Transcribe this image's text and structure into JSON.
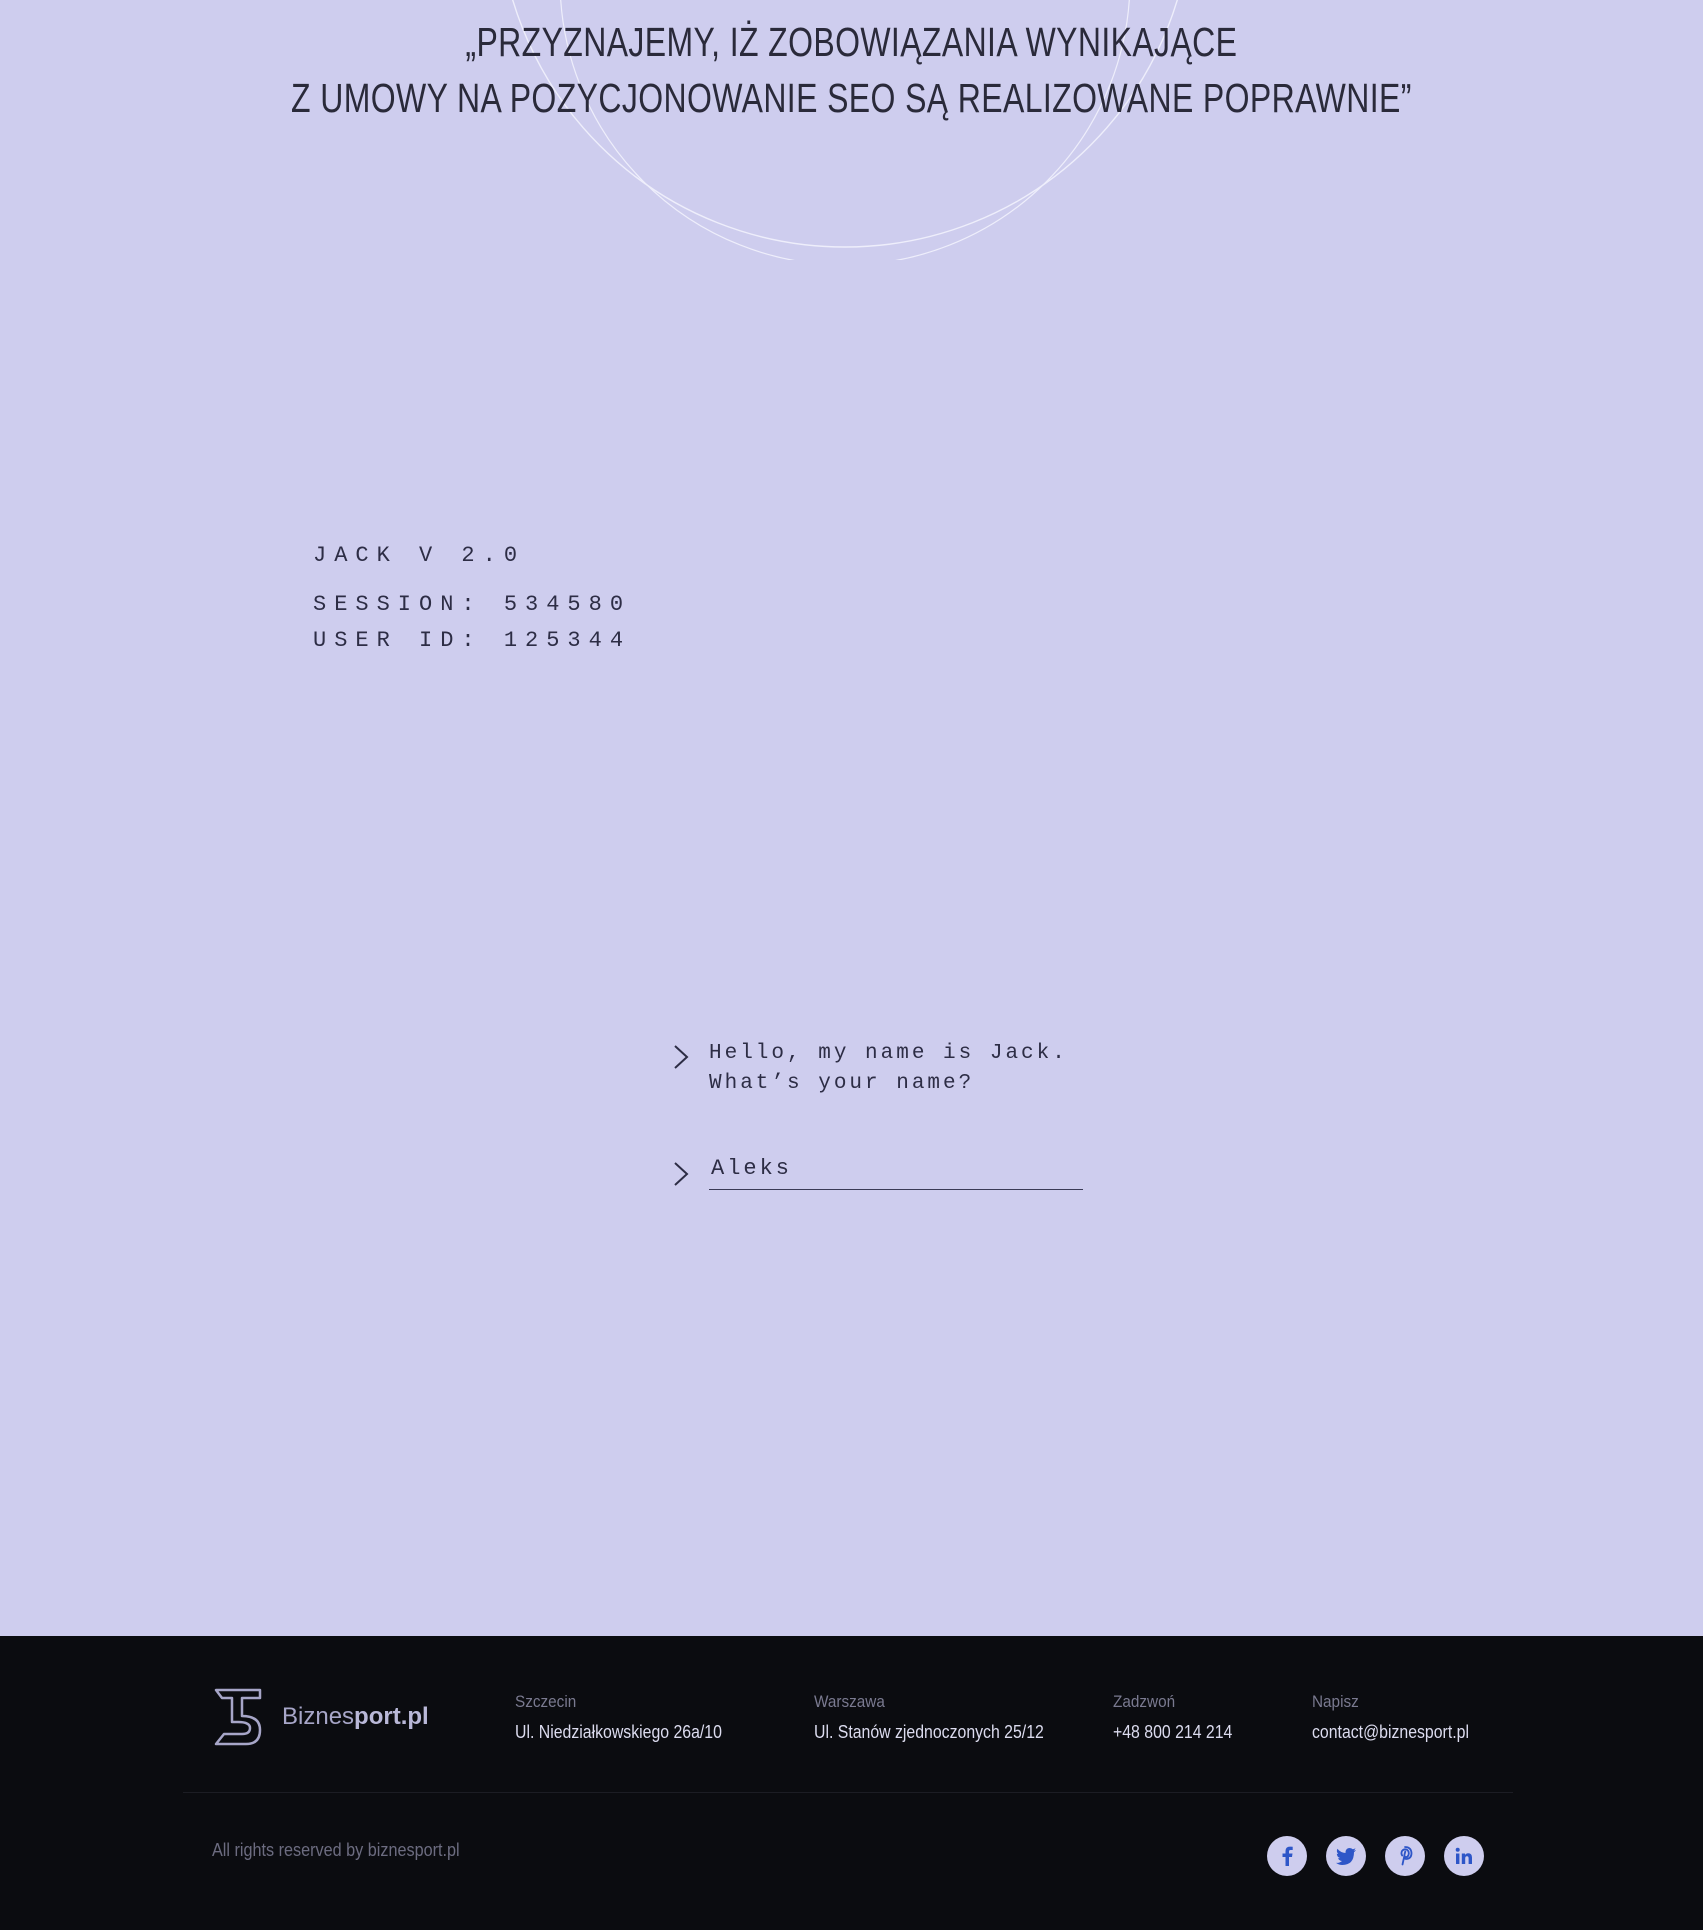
{
  "headline": {
    "line1": "„PRZYZNAJEMY, IŻ ZOBOWIĄZANIA WYNIKAJĄCE",
    "line2": "Z UMOWY NA POZYCJONOWANIE SEO SĄ REALIZOWANE POPRAWNIE”"
  },
  "terminal": {
    "title": "JACK V 2.0",
    "session": "SESSION: 534580",
    "user_id": "USER ID: 125344"
  },
  "chat": {
    "bot_line1": "Hello, my name is Jack.",
    "bot_line2": "What’s your name?",
    "answer_value": "Aleks"
  },
  "footer": {
    "brand_prefix": "Biznes",
    "brand_bold": "port.pl",
    "contacts": [
      {
        "label": "Szczecin",
        "value": "Ul. Niedziałkowskiego 26a/10"
      },
      {
        "label": "Warszawa",
        "value": "Ul. Stanów zjednoczonych 25/12"
      },
      {
        "label": "Zadzwoń",
        "value": "+48 800 214 214"
      },
      {
        "label": "Napisz",
        "value": "contact@biznesport.pl"
      }
    ],
    "copyright": "All rights reserved by biznesport.pl",
    "social": [
      {
        "icon": "facebook-icon",
        "glyph": "f"
      },
      {
        "icon": "twitter-icon",
        "glyph": "t"
      },
      {
        "icon": "pinterest-icon",
        "glyph": "p"
      },
      {
        "icon": "linkedin-icon",
        "glyph": "in"
      }
    ]
  },
  "colors": {
    "background": "#cecdee",
    "footer_bg": "#0b0c10",
    "text_dark": "#2d2d45",
    "social_icon": "#2e56c8"
  }
}
